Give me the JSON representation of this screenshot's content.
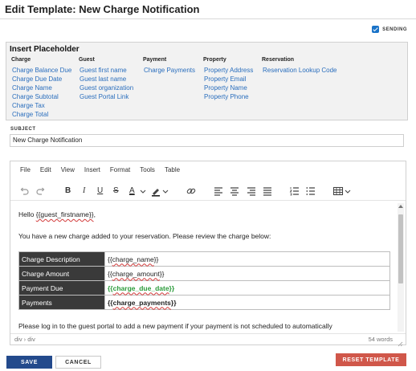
{
  "page": {
    "title": "Edit Template: New Charge Notification",
    "sending_label": "SENDING",
    "sending_checked": true
  },
  "placeholders": {
    "title": "Insert Placeholder",
    "columns": [
      {
        "heading": "Charge",
        "items": [
          "Charge Balance Due",
          "Charge Due Date",
          "Charge Name",
          "Charge Subtotal",
          "Charge Tax",
          "Charge Total"
        ]
      },
      {
        "heading": "Guest",
        "items": [
          "Guest first name",
          "Guest last name",
          "Guest organization",
          "Guest Portal Link"
        ]
      },
      {
        "heading": "Payment",
        "items": [
          "Charge Payments"
        ]
      },
      {
        "heading": "Property",
        "items": [
          "Property Address",
          "Property Email",
          "Property Name",
          "Property Phone"
        ]
      },
      {
        "heading": "Reservation",
        "items": [
          "Reservation Lookup Code"
        ]
      }
    ]
  },
  "subject": {
    "label": "SUBJECT",
    "value": "New Charge Notification"
  },
  "editor": {
    "menu": [
      "File",
      "Edit",
      "View",
      "Insert",
      "Format",
      "Tools",
      "Table"
    ],
    "toolbar_letters": {
      "bold": "B",
      "italic": "I",
      "underline": "U",
      "strike": "S",
      "font_color": "A"
    },
    "content": {
      "greeting_prefix": "Hello ",
      "greeting_token": "{{guest_firstname}}",
      "greeting_suffix": ",",
      "intro": "You have a new charge added to your reservation. Please review the charge below:",
      "table": [
        {
          "label": "Charge Description",
          "value_prefix": "{{",
          "value_token": "charge_name",
          "value_suffix": "}}"
        },
        {
          "label": "Charge Amount",
          "value_prefix": "{{",
          "value_token": "charge_amount",
          "value_suffix": "}}"
        },
        {
          "label": "Payment Due",
          "value_prefix": "{{",
          "value_token": "charge_due_date",
          "value_suffix": "}}"
        },
        {
          "label": "Payments",
          "value_prefix": "{{",
          "value_token": "charge_payments",
          "value_suffix": "}}"
        }
      ],
      "footer_text": "Please log in to the guest portal to add a new payment if your payment is not scheduled to automatically"
    },
    "status_path": "div › div",
    "word_count": "54 words"
  },
  "buttons": {
    "save": "SAVE",
    "cancel": "CANCEL",
    "reset": "RESET TEMPLATE"
  },
  "colors": {
    "link": "#2a6ebd",
    "save_button": "#234a8c",
    "reset_button": "#d0574a",
    "table_label_bg": "#3a3a3a",
    "green_token": "#2a9b3a"
  }
}
